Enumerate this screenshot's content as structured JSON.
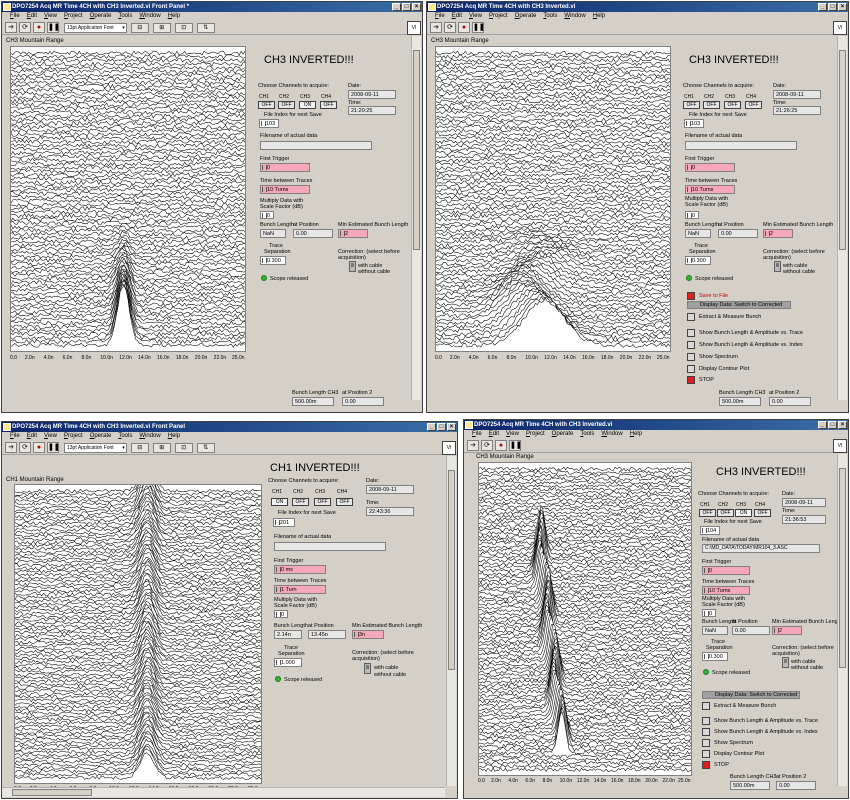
{
  "windows": [
    {
      "title": "DPO7254 Acq MR Time 4CH with CH3 Inverted.vi Front Panel *",
      "menu": [
        "File",
        "Edit",
        "View",
        "Project",
        "Operate",
        "Tools",
        "Window",
        "Help"
      ],
      "font_select": "13pt Application Font",
      "chart_label": "CH3 Mountain Range",
      "heading": "CH3 INVERTED!!!",
      "choose_label": "Choose Channels to acquire:",
      "channels": [
        {
          "name": "CH1",
          "state": "OFF"
        },
        {
          "name": "CH2",
          "state": "OFF"
        },
        {
          "name": "CH3",
          "state": "ON"
        },
        {
          "name": "CH4",
          "state": "OFF"
        }
      ],
      "file_index_label": "File Index for next Save",
      "file_index": "103",
      "date_label": "Date:",
      "date": "2008-09-11",
      "time_label": "Time:",
      "time": "21:20:25",
      "filename_label": "Filename of actual data",
      "filename": "",
      "first_trigger_label": "First Trigger",
      "first_trigger": "0",
      "time_between_label": "Time between Traces",
      "time_between": "10 Turns",
      "multiply_label": "Multiply Data with Scale Factor (dB)",
      "multiply": "0",
      "bunch_length_label": "Bunch Length",
      "bunch_length": "NaN",
      "at_position_label": "at Position",
      "at_position": "0.00",
      "min_est_label": "Min Estimated Bunch Length",
      "min_est": "2",
      "trace_sep_label": "Trace Separation",
      "trace_sep": "0.300",
      "correction_label": "Correction: (select before acquisition)",
      "with_cable": "with cable",
      "without_cable": "without cable",
      "scope_label": "Scope released",
      "bottom_bunch_label": "Bunch Length CH3",
      "bottom_bunch": "500.00m",
      "bottom_pos_label": "at Position 2",
      "bottom_pos": "0.00",
      "peak_x": 12.0,
      "x_ticks": [
        "0.0",
        "2.0n",
        "4.0n",
        "6.0n",
        "8.0n",
        "10.0n",
        "12.0n",
        "14.0n",
        "16.0n",
        "18.0n",
        "20.0n",
        "22.0n",
        "25.0n"
      ]
    },
    {
      "title": "DPO7254 Acq MR Time 4CH with CH3 Inverted.vi",
      "menu": [
        "File",
        "Edit",
        "View",
        "Project",
        "Operate",
        "Tools",
        "Window",
        "Help"
      ],
      "chart_label": "CH3 Mountain Range",
      "heading": "CH3 INVERTED!!!",
      "choose_label": "Choose Channels to acquire:",
      "channels": [
        {
          "name": "CH1",
          "state": "OFF"
        },
        {
          "name": "CH2",
          "state": "OFF"
        },
        {
          "name": "CH3",
          "state": "OFF"
        },
        {
          "name": "CH4",
          "state": "OFF"
        }
      ],
      "file_index_label": "File Index for next Save",
      "file_index": "103",
      "date_label": "Date:",
      "date": "2008-09-11",
      "time_label": "Time:",
      "time": "21:26:25",
      "filename_label": "Filename of actual data",
      "filename": "",
      "first_trigger_label": "First Trigger",
      "first_trigger": "0",
      "time_between_label": "Time between Traces",
      "time_between": "10 Turns",
      "multiply_label": "Multiply Data with Scale Factor (dB)",
      "multiply": "0",
      "bunch_length_label": "Bunch Length",
      "bunch_length": "NaN",
      "at_position_label": "at Position",
      "at_position": "0.00",
      "min_est_label": "Min Estimated Bunch Length",
      "min_est": "2",
      "trace_sep_label": "Trace Separation",
      "trace_sep": "0.300",
      "correction_label": "Correction: (select before acquisition)",
      "with_cable": "with cable",
      "without_cable": "without cable",
      "scope_label": "Scope released",
      "save_label": "Save to File",
      "display_data": "Display Data: Switch to Corrected",
      "extract_label": "Extract & Measure Bunch",
      "show_bl_trace": "Show Bunch Length & Amplitude vs. Trace",
      "show_bl_index": "Show Bunch Length & Amplitude vs. Index",
      "show_spectrum": "Show Spectrum",
      "display_contour": "Display Contour Plot",
      "stop_label": "STOP",
      "bottom_bunch_label": "Bunch Length CH3",
      "bottom_bunch": "500.00m",
      "bottom_pos_label": "at Position 2",
      "bottom_pos": "0.00",
      "x_ticks": [
        "0.0",
        "2.0n",
        "4.0n",
        "6.0n",
        "8.0n",
        "10.0n",
        "12.0n",
        "14.0n",
        "16.0n",
        "18.0n",
        "20.0n",
        "22.0n",
        "25.0n"
      ]
    },
    {
      "title": "DPO7254 Acq MR Time 4CH with CH3 Inverted.vi Front Panel",
      "menu": [
        "File",
        "Edit",
        "View",
        "Project",
        "Operate",
        "Tools",
        "Window",
        "Help"
      ],
      "font_select": "13pt Application Font",
      "chart_label": "CH1 Mountain Range",
      "heading": "CH1 INVERTED!!!",
      "choose_label": "Choose Channels to acquire:",
      "channels": [
        {
          "name": "CH1",
          "state": "ON"
        },
        {
          "name": "CH2",
          "state": "OFF"
        },
        {
          "name": "CH3",
          "state": "OFF"
        },
        {
          "name": "CH4",
          "state": "OFF"
        }
      ],
      "file_index_label": "File Index for next Save",
      "file_index": "201",
      "date_label": "Date:",
      "date": "2008-09-11",
      "time_label": "Time:",
      "time": "22:43:36",
      "filename_label": "Filename of actual data",
      "filename": "",
      "first_trigger_label": "First Trigger",
      "first_trigger": "0 ms",
      "time_between_label": "Time between Traces",
      "time_between": "1 Turn",
      "multiply_label": "Multiply Data with Scale Factor (dB)",
      "multiply": "0",
      "bunch_length_label": "Bunch Length",
      "bunch_length": "2.14n",
      "at_position_label": "at Position",
      "at_position": "13.45n",
      "min_est_label": "Min Estimated Bunch Length",
      "min_est": "3n",
      "trace_sep_label": "Trace Separation",
      "trace_sep": "1.000",
      "correction_label": "Correction: (select before acquisition)",
      "with_cable": "with cable",
      "without_cable": "without cable",
      "scope_label": "Scope released",
      "peak_x": 13.45,
      "x_ticks": [
        "0.0",
        "2.0n",
        "4.0n",
        "6.0n",
        "8.0n",
        "10.0n",
        "12.0n",
        "14.0n",
        "16.0n",
        "18.0n",
        "20.0n",
        "22.0n",
        "25.0n"
      ]
    },
    {
      "title": "DPO7254 Acq MR Time 4CH with CH3 Inverted.vi",
      "menu": [
        "File",
        "Edit",
        "View",
        "Project",
        "Operate",
        "Tools",
        "Window",
        "Help"
      ],
      "chart_label": "CH3 Mountain Range",
      "heading": "CH3 INVERTED!!!",
      "choose_label": "Choose Channels to acquire:",
      "channels": [
        {
          "name": "CH1",
          "state": "OFF"
        },
        {
          "name": "CH2",
          "state": "OFF"
        },
        {
          "name": "CH3",
          "state": "ON"
        },
        {
          "name": "CH4",
          "state": "OFF"
        }
      ],
      "file_index_label": "File Index for next Save",
      "file_index": "104",
      "date_label": "Date:",
      "date": "2008-09-11",
      "time_label": "Time:",
      "time": "21:36:53",
      "filename_label": "Filename of actual data",
      "filename": "C:\\MD_DATA\\TODAY\\MR104_3.ASC",
      "first_trigger_label": "First Trigger",
      "first_trigger": "0",
      "time_between_label": "Time between Traces",
      "time_between": "10 Turns",
      "multiply_label": "Multiply Data with Scale Factor (dB)",
      "multiply": "0",
      "bunch_length_label": "Bunch Length",
      "bunch_length": "NaN",
      "at_position_label": "at Position",
      "at_position": "0.00",
      "min_est_label": "Min Estimated Bunch Length",
      "min_est": "2",
      "trace_sep_label": "Trace Separation",
      "trace_sep": "0.300",
      "correction_label": "Correction: (select before acquisition)",
      "with_cable": "with cable",
      "without_cable": "without cable",
      "scope_label": "Scope released",
      "display_data": "Display Data: Switch to Corrected",
      "extract_label": "Extract & Measure Bunch",
      "show_bl_trace": "Show Bunch Length & Amplitude vs. Trace",
      "show_bl_index": "Show Bunch Length & Amplitude vs. Index",
      "show_spectrum": "Show Spectrum",
      "display_contour": "Display Contour Plot",
      "stop_label": "STOP",
      "bottom_bunch_label": "Bunch Length CH3",
      "bottom_bunch": "500.00m",
      "bottom_pos_label": "at Position 2",
      "bottom_pos": "0.00",
      "x_ticks": [
        "0.0",
        "2.0n",
        "4.0n",
        "6.0n",
        "8.0n",
        "10.0n",
        "12.0n",
        "14.0n",
        "16.0n",
        "18.0n",
        "20.0n",
        "22.0n",
        "25.0n"
      ]
    }
  ],
  "colors": {
    "titlebar_start": "#0a246a",
    "titlebar_end": "#3a6ea5",
    "panel": "#d4d0c8",
    "pink": "#f7a8b8",
    "led": "#2fb62f",
    "stop": "#e02020"
  },
  "chart_data": [
    {
      "type": "line",
      "chart": "CH3 Mountain Range (window 1)",
      "x_range_ns": [
        0,
        25
      ],
      "trace_count": 80,
      "peak_position_ns": 12.0,
      "peak_width_ns": 0.9
    },
    {
      "type": "line",
      "chart": "CH3 Mountain Range (window 2)",
      "x_range_ns": [
        0,
        25
      ],
      "trace_count": 80,
      "peak_position_ns": 10.5,
      "peak_width_ns": 3.0
    },
    {
      "type": "line",
      "chart": "CH1 Mountain Range (window 3)",
      "x_range_ns": [
        0,
        25
      ],
      "trace_count": 90,
      "peak_position_ns": 13.45,
      "peak_width_ns": 1.0
    },
    {
      "type": "line",
      "chart": "CH3 Mountain Range (window 4)",
      "x_range_ns": [
        0,
        25
      ],
      "trace_count": 90,
      "peak_position_ns": 7.5,
      "peak_width_ns": 1.2
    }
  ]
}
